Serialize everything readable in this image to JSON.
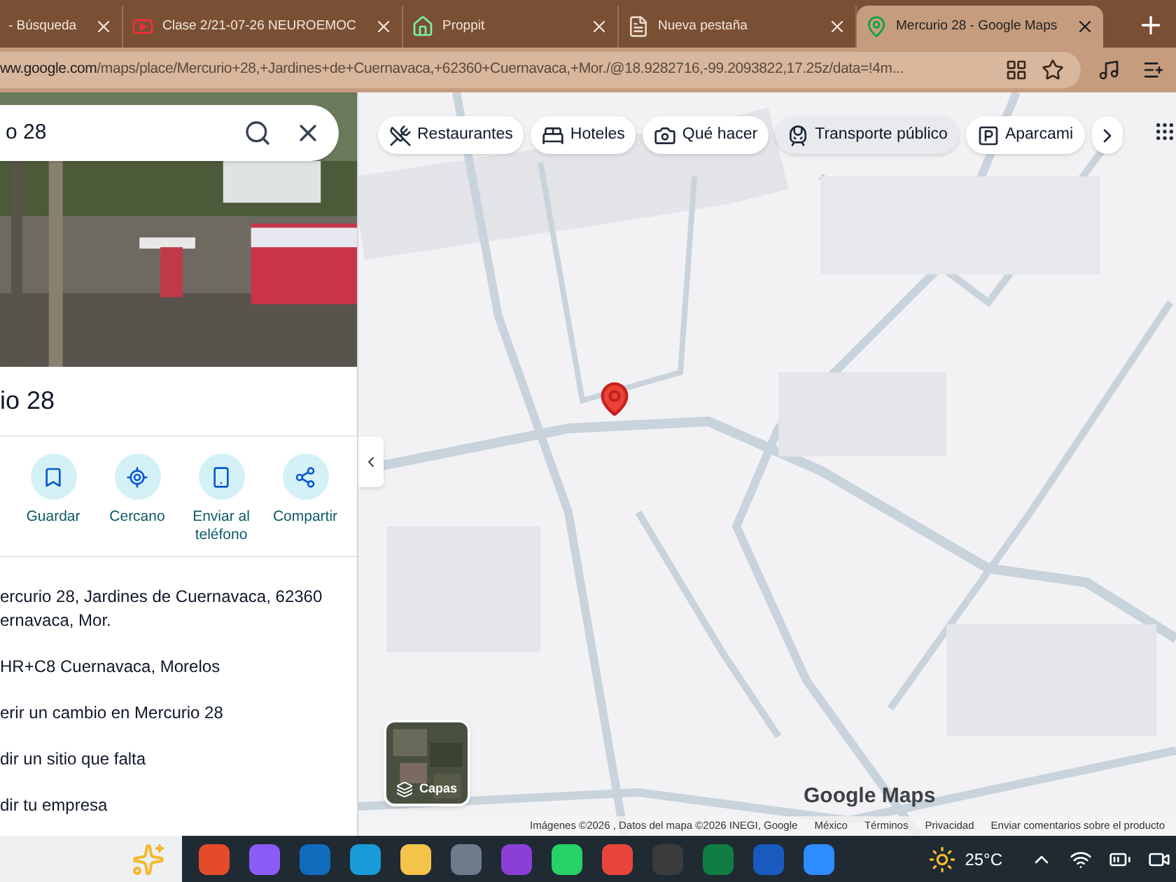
{
  "tabs": [
    {
      "title": "- Búsqueda",
      "selected": false,
      "kind": "plain"
    },
    {
      "title": "Clase 2/21-07-26 NEUROEMOC",
      "selected": false,
      "kind": "video"
    },
    {
      "title": "Proppit",
      "selected": false,
      "kind": "house"
    },
    {
      "title": "Nueva pestaña",
      "selected": false,
      "kind": "page"
    },
    {
      "title": "Mercurio 28 - Google Maps",
      "selected": true,
      "kind": "maps"
    }
  ],
  "address_bar": {
    "host": "ww.google.com",
    "path": "/maps/place/Mercurio+28,+Jardines+de+Cuernavaca,+62360+Cuernavaca,+Mor./@18.9282716,-99.2093822,17.25z/data=!4m..."
  },
  "place_panel": {
    "search_value": "o 28",
    "title": "io 28",
    "actions": [
      {
        "label": "Guardar",
        "kind": "save"
      },
      {
        "label": "Cercano",
        "kind": "nearby"
      },
      {
        "label": "Enviar al teléfono",
        "kind": "phone"
      },
      {
        "label": "Compartir",
        "kind": "share"
      }
    ],
    "details": [
      "ercurio 28, Jardines de Cuernavaca, 62360 ernavaca, Mor.",
      "HR+C8 Cuernavaca, Morelos",
      "erir un cambio en Mercurio 28",
      "dir un sitio que falta",
      "dir tu empresa"
    ]
  },
  "map": {
    "categories": [
      {
        "label": "Restaurantes",
        "kind": "food",
        "selected": false
      },
      {
        "label": "Hoteles",
        "kind": "bed",
        "selected": false
      },
      {
        "label": "Qué hacer",
        "kind": "camera",
        "selected": false
      },
      {
        "label": "Transporte público",
        "kind": "transit",
        "selected": true
      },
      {
        "label": "Aparcami",
        "kind": "parking",
        "selected": false
      }
    ],
    "layers_label": "Capas",
    "logo": "Google Maps",
    "footer": [
      "Imágenes ©2026 , Datos del mapa ©2026 INEGI, Google",
      "México",
      "Términos",
      "Privacidad",
      "Enviar comentarios sobre el producto"
    ]
  },
  "taskbar": {
    "weather": "25°C"
  }
}
